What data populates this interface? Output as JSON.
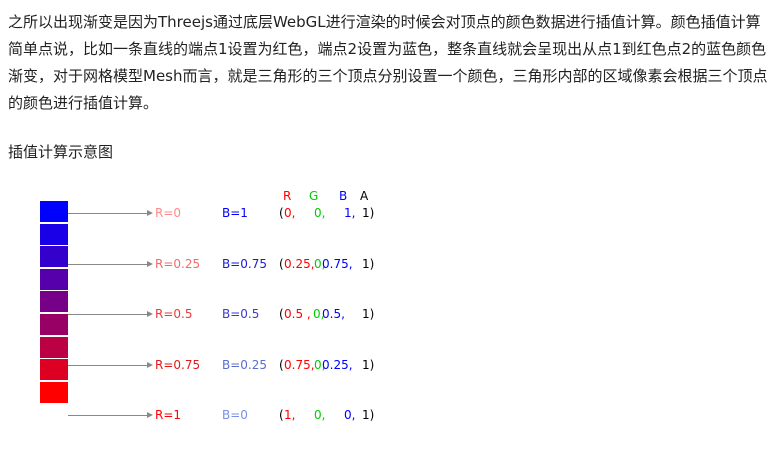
{
  "paragraph": "之所以出现渐变是因为Threejs通过底层WebGL进行渲染的时候会对顶点的颜色数据进行插值计算。颜色插值计算简单点说，比如一条直线的端点1设置为红色，端点2设置为蓝色，整条直线就会呈现出从点1到红色点2的蓝色颜色渐变，对于网格模型Mesh而言，就是三角形的三个顶点分别设置一个颜色，三角形内部的区域像素会根据三个顶点的颜色进行插值计算。",
  "section_title": "插值计算示意图",
  "header": {
    "r": "R",
    "g": "G",
    "b": "B",
    "a": "A"
  },
  "colors": {
    "red": "#ff0000",
    "green": "#00cc00",
    "blue": "#0000ff",
    "black": "#000000"
  },
  "gradient_cells": [
    "#0000ff",
    "#1a00e6",
    "#3300cc",
    "#5500aa",
    "#770088",
    "#990066",
    "#bb0044",
    "#dd0022",
    "#ff0000"
  ],
  "rows": [
    {
      "r_label": "R=0",
      "b_label": "B=1",
      "r_color": "#ff8a8a",
      "b_color": "#0000ff",
      "t_open": "(",
      "t_r": "0,",
      "t_g": "0,",
      "t_b": "1,",
      "t_a": "1)"
    },
    {
      "r_label": "R=0.25",
      "b_label": "B=0.75",
      "r_color": "#f06a6a",
      "b_color": "#1a1ad9",
      "t_open": "(",
      "t_r": "0.25,",
      "t_g": "0,",
      "t_b": "0.75,",
      "t_a": "1)"
    },
    {
      "r_label": "R=0.5",
      "b_label": "B=0.5",
      "r_color": "#e83a3a",
      "b_color": "#3a3acc",
      "t_open": "(",
      "t_r": "0.5 ,",
      "t_g": "0,",
      "t_b": "0.5,",
      "t_a": "1)"
    },
    {
      "r_label": "R=0.75",
      "b_label": "B=0.25",
      "r_color": "#e01a1a",
      "b_color": "#5c6ecc",
      "t_open": "(",
      "t_r": "0.75,",
      "t_g": "0,",
      "t_b": "0.25,",
      "t_a": "1)"
    },
    {
      "r_label": "R=1",
      "b_label": "B=0",
      "r_color": "#ff0000",
      "b_color": "#7a90e0",
      "t_open": "(",
      "t_r": "1,",
      "t_g": "0,",
      "t_b": "0,",
      "t_a": "1)"
    }
  ]
}
